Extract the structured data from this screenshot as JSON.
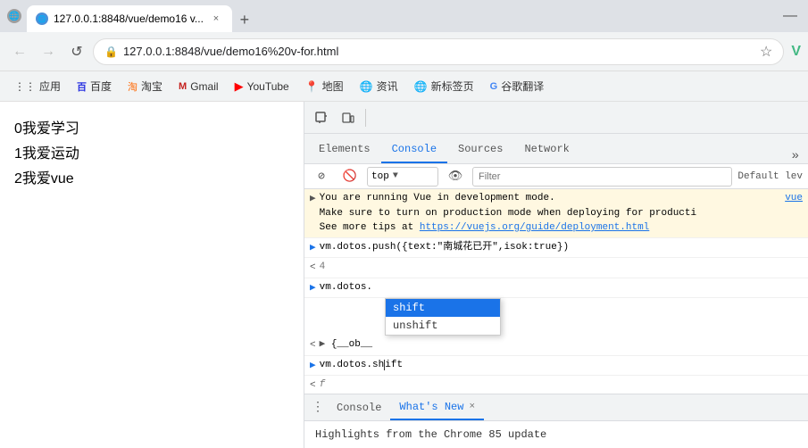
{
  "titleBar": {
    "favicon": "🌐",
    "tabTitle": "127.0.0.1:8848/vue/demo16 v...",
    "closeLabel": "×",
    "newTabLabel": "+",
    "minimizeLabel": "—"
  },
  "navBar": {
    "backBtn": "←",
    "forwardBtn": "→",
    "reloadBtn": "↺",
    "addressIcon": "🔒",
    "addressUrl": "127.0.0.1:8848/vue/demo16%20v-for.html",
    "starIcon": "☆",
    "vueIcon": "V"
  },
  "bookmarks": [
    {
      "id": "apps",
      "icon": "⋮⋮⋮",
      "label": "应用"
    },
    {
      "id": "baidu",
      "icon": "百",
      "label": "百度"
    },
    {
      "id": "taobao",
      "icon": "淘",
      "label": "淘宝"
    },
    {
      "id": "gmail",
      "icon": "M",
      "label": "Gmail"
    },
    {
      "id": "youtube",
      "icon": "▶",
      "label": "YouTube"
    },
    {
      "id": "maps",
      "icon": "📍",
      "label": "地图"
    },
    {
      "id": "news",
      "icon": "🌐",
      "label": "资讯"
    },
    {
      "id": "newtab",
      "icon": "🌐",
      "label": "新标签页"
    },
    {
      "id": "translate",
      "icon": "G",
      "label": "谷歌翻译"
    }
  ],
  "pageContent": {
    "items": [
      {
        "prefix": "0",
        "text": "我爱学习"
      },
      {
        "prefix": "1",
        "text": "我爱运动"
      },
      {
        "prefix": "2",
        "text": "我爱vue"
      }
    ]
  },
  "devtools": {
    "tabs": [
      "Elements",
      "Console",
      "Sources",
      "Network"
    ],
    "activeTab": "Console",
    "moreIcon": "»",
    "toolbar": {
      "inspectIcon": "⬚",
      "responsiveIcon": "⊞",
      "stopIcon": "🚫",
      "topLabel": "top",
      "eyeIcon": "👁",
      "filterPlaceholder": "Filter",
      "defaultLevel": "Default lev"
    },
    "consoleMessages": [
      {
        "type": "warning",
        "arrow": "▶",
        "text": "You are running Vue in development mode.\nMake sure to turn on production mode when deploying for producti\nSee more tips at https://vuejs.org/guide/deployment.html",
        "source": "vue",
        "hasLink": true,
        "linkText": "https://vuejs.org/guide/deployment.html"
      },
      {
        "type": "input",
        "arrow": ">",
        "text": "vm.dotos.push({text:\"南城花已开\",isok:true})"
      },
      {
        "type": "result",
        "arrow": "<",
        "text": "4"
      },
      {
        "type": "input",
        "arrow": ">",
        "text": "vm.dotos."
      },
      {
        "type": "expand",
        "arrow": "<",
        "expandArrow": "▶",
        "text": "{__ob__"
      },
      {
        "type": "input",
        "arrow": ">",
        "text": "vm.dotos.shift"
      },
      {
        "type": "result",
        "arrow": "<",
        "text": "f"
      }
    ],
    "autocomplete": {
      "items": [
        {
          "label": "shift",
          "selected": true
        },
        {
          "label": "unshift",
          "selected": false
        }
      ]
    },
    "currentInput": "vm.dotos.sh|ft",
    "bottomTabs": {
      "menuIcon": "⋮",
      "consoleLabel": "Console",
      "whatsNewLabel": "What's New",
      "closeIcon": "×"
    },
    "whatsNew": {
      "text": "Highlights from the Chrome 85 update"
    }
  }
}
